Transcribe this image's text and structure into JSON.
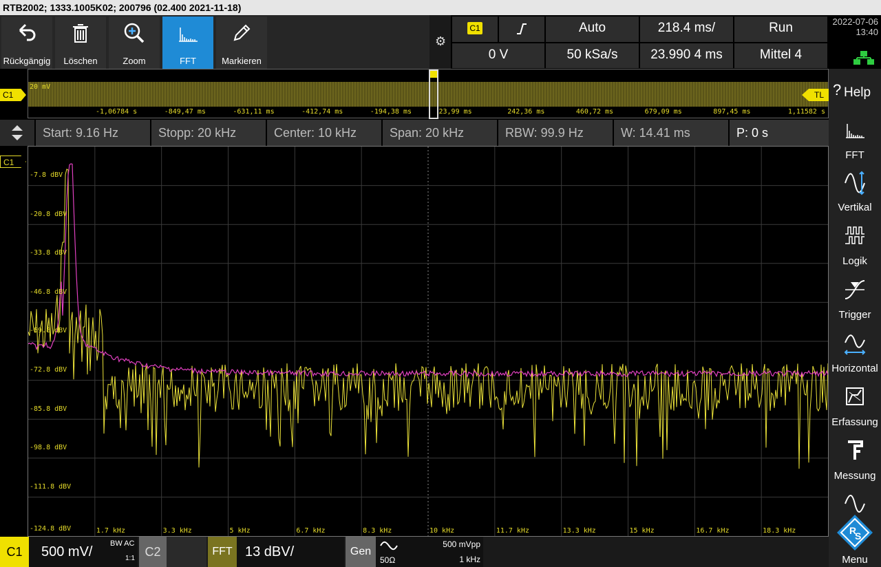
{
  "window": {
    "title": "RTB2002; 1333.1005K02; 200796 (02.400 2021-11-18)"
  },
  "toolbar": {
    "buttons": [
      {
        "label": "Rückgängig",
        "icon": "undo-icon"
      },
      {
        "label": "Löschen",
        "icon": "trash-icon"
      },
      {
        "label": "Zoom",
        "icon": "zoom-icon"
      },
      {
        "label": "FFT",
        "icon": "fft-icon",
        "active": true
      },
      {
        "label": "Markieren",
        "icon": "pen-icon"
      }
    ]
  },
  "trigger": {
    "source": "C1",
    "slope_icon": "rising-edge-icon",
    "mode": "Auto",
    "timebase": "218.4 ms/",
    "run_state": "Run",
    "level": "0 V",
    "sample_rate": "50 kSa/s",
    "position": "23.990 4 ms",
    "acquisition": "Mittel 4"
  },
  "datetime": {
    "date": "2022-07-06",
    "time": "13:40"
  },
  "overview": {
    "channel": "C1",
    "scale_label": "20 mV",
    "right_marker": "TL",
    "ticks": [
      "-1,06784 s",
      "-849,47 ms",
      "-631,11 ms",
      "-412,74 ms",
      "-194,38 ms",
      "23,99 ms",
      "242,36 ms",
      "460,72 ms",
      "679,09 ms",
      "897,45 ms",
      "1,11582 s"
    ]
  },
  "fft_info": {
    "start": "Start: 9.16 Hz",
    "stop": "Stopp: 20 kHz",
    "center": "Center: 10 kHz",
    "span": "Span: 20 kHz",
    "rbw": "RBW: 99.9 Hz",
    "window": "W: 14.41 ms",
    "position": "P: 0 s"
  },
  "plot": {
    "channel": "C1",
    "y_labels": [
      "-7.8 dBV",
      "-20.8 dBV",
      "-33.8 dBV",
      "-46.8 dBV",
      "-59.8 dBV",
      "-72.8 dBV",
      "-85.8 dBV",
      "-98.8 dBV",
      "-111.8 dBV",
      "-124.8 dBV"
    ],
    "x_labels": [
      "1.7 kHz",
      "3.3 kHz",
      "5 kHz",
      "6.7 kHz",
      "8.3 kHz",
      "10 kHz",
      "11.7 kHz",
      "13.3 kHz",
      "15 kHz",
      "16.7 kHz",
      "18.3 kHz"
    ],
    "colors": {
      "spectrum": "#ece33a",
      "average": "#e040c0",
      "grid": "#3a3a3a"
    }
  },
  "sidebar": {
    "items": [
      {
        "label": "Help",
        "icon": "help-icon"
      },
      {
        "label": "FFT",
        "icon": "fft-icon"
      },
      {
        "label": "Vertikal",
        "icon": "sine-icon"
      },
      {
        "label": "Logik",
        "icon": "logic-icon"
      },
      {
        "label": "Trigger",
        "icon": "trigger-icon"
      },
      {
        "label": "Horizontal",
        "icon": "horizontal-icon"
      },
      {
        "label": "Erfassung",
        "icon": "acquisition-icon"
      },
      {
        "label": "Messung",
        "icon": "measure-icon"
      },
      {
        "label": "Menu",
        "icon": "rs-logo-icon"
      }
    ]
  },
  "bottom": {
    "c1_label": "C1",
    "c1_scale": "500 mV/",
    "c1_bw": "BW AC",
    "c1_ratio": "1:1",
    "c2_label": "C2",
    "fft_label": "FFT",
    "fft_scale": "13 dBV/",
    "gen_label": "Gen",
    "gen_impedance": "50Ω",
    "gen_amplitude": "500 mVpp",
    "gen_freq": "1 kHz"
  }
}
